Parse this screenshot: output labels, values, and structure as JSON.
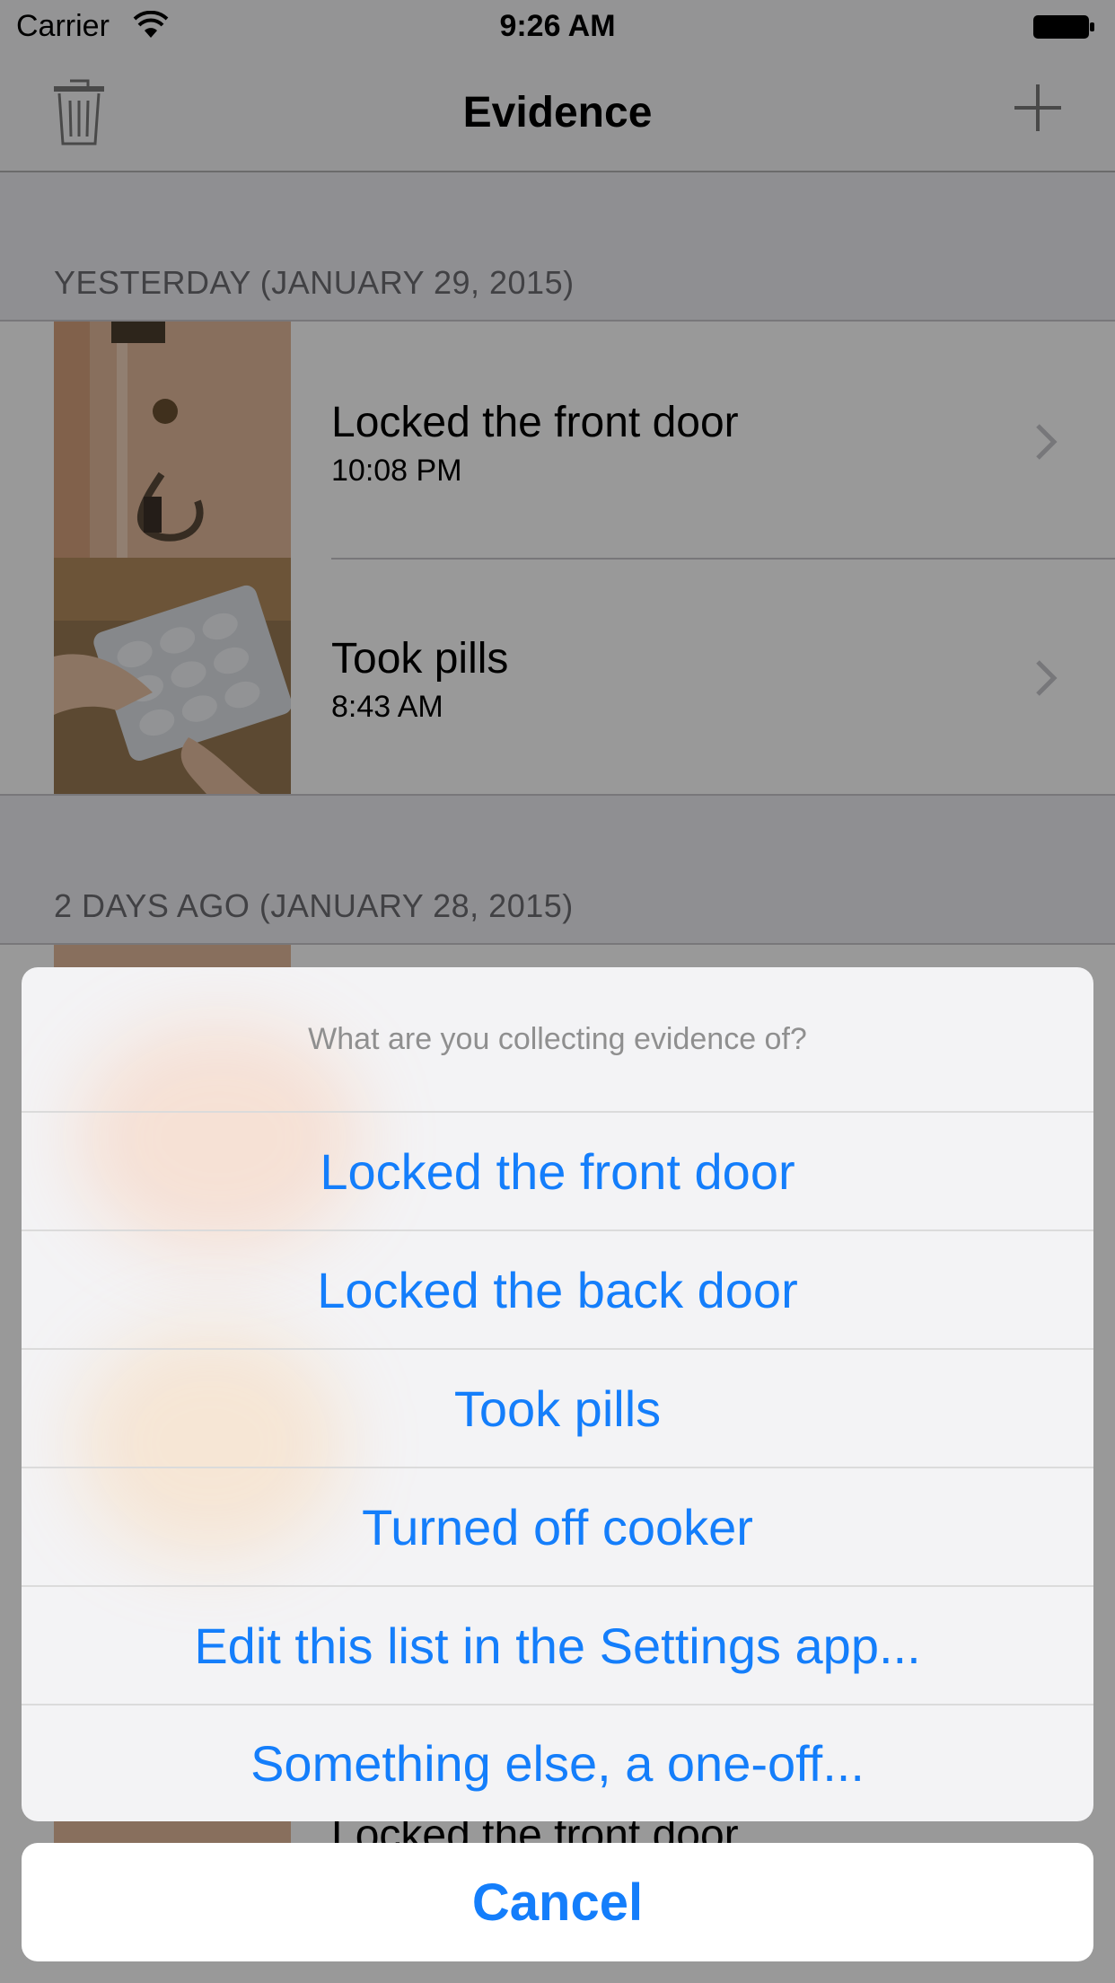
{
  "status_bar": {
    "carrier": "Carrier",
    "time": "9:26 AM"
  },
  "navbar": {
    "title": "Evidence"
  },
  "sections": [
    {
      "header": "YESTERDAY (JANUARY 29, 2015)",
      "rows": [
        {
          "title": "Locked the front door",
          "time": "10:08 PM",
          "thumb": "door-lock-photo"
        },
        {
          "title": "Took pills",
          "time": "8:43 AM",
          "thumb": "pill-blister-photo"
        }
      ]
    },
    {
      "header": "2 DAYS AGO (JANUARY 28, 2015)",
      "rows": []
    }
  ],
  "background_partial_row_title": "Locked the front door",
  "action_sheet": {
    "title": "What are you collecting evidence of?",
    "items": [
      "Locked the front door",
      "Locked the back door",
      "Took pills",
      "Turned off cooker",
      "Edit this list in the Settings app...",
      "Something else, a one-off..."
    ],
    "cancel_label": "Cancel"
  },
  "colors": {
    "accent": "#147efb",
    "background": "#efeff4",
    "separator": "#c8c7cc"
  }
}
